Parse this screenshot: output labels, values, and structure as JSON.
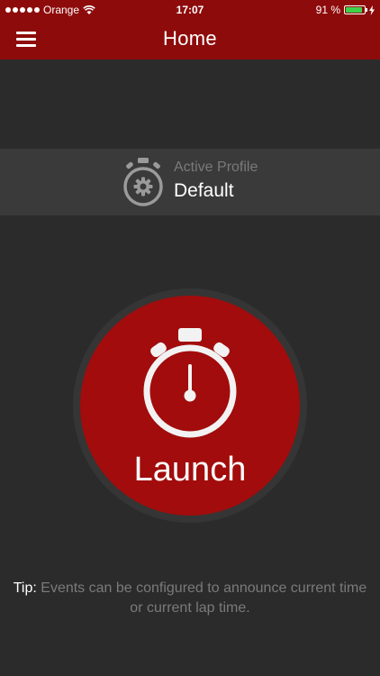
{
  "status_bar": {
    "carrier": "Orange",
    "time": "17:07",
    "battery_text": "91 %",
    "battery_level": 0.91,
    "battery_color": "#3ed14a"
  },
  "nav": {
    "title": "Home",
    "menu_icon": "hamburger-menu-icon"
  },
  "profile": {
    "caption": "Active Profile",
    "name": "Default",
    "icon": "stopwatch-gear-icon"
  },
  "launch": {
    "label": "Launch",
    "icon": "stopwatch-icon"
  },
  "tip": {
    "label": "Tip:",
    "text": "Events can be configured to announce current time or current lap time."
  },
  "colors": {
    "brand": "#8e0b0b",
    "launch_button": "#a20c0c",
    "background": "#2b2b2b",
    "muted_text": "#7a7a7a"
  }
}
